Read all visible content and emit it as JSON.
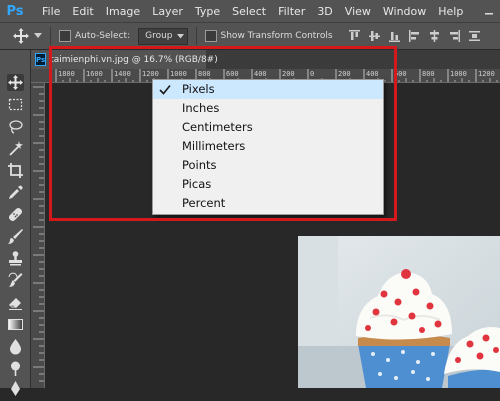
{
  "menubar": {
    "logo": "Ps",
    "items": [
      "File",
      "Edit",
      "Image",
      "Layer",
      "Type",
      "Select",
      "Filter",
      "3D",
      "View",
      "Window",
      "Help"
    ]
  },
  "options": {
    "auto_select_label": "Auto-Select:",
    "auto_select_value": "Group",
    "show_transform_label": "Show Transform Controls"
  },
  "document": {
    "tab_title": "taimienphi.vn.jpg @ 16.7% (RGB/8#)"
  },
  "ruler": {
    "top_labels": [
      "1800",
      "1600",
      "1400",
      "1200",
      "1000",
      "800",
      "600",
      "400",
      "200",
      "0",
      "200",
      "400",
      "600",
      "800",
      "1000",
      "1200",
      "1400"
    ]
  },
  "units_menu": {
    "selected": "Pixels",
    "items": [
      "Pixels",
      "Inches",
      "Centimeters",
      "Millimeters",
      "Points",
      "Picas",
      "Percent"
    ]
  },
  "colors": {
    "ui_panel": "#535353",
    "canvas": "#282828",
    "highlight": "#d5181c",
    "selection": "#cce8ff",
    "ps_blue": "#31a8ff"
  },
  "tools": [
    "move-icon",
    "marquee-icon",
    "lasso-icon",
    "magic-wand-icon",
    "crop-icon",
    "eyedropper-icon",
    "healing-brush-icon",
    "brush-icon",
    "clone-stamp-icon",
    "history-brush-icon",
    "eraser-icon",
    "gradient-icon",
    "blur-icon",
    "dodge-icon",
    "pen-icon"
  ]
}
